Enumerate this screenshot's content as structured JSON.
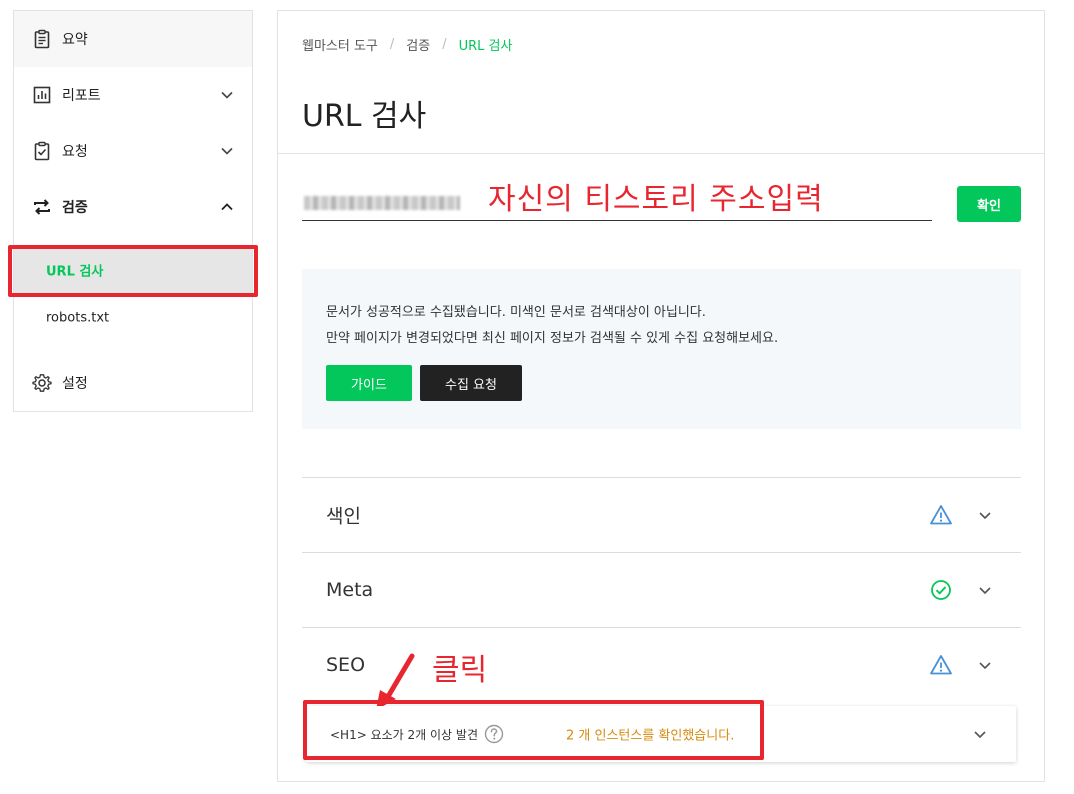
{
  "sidebar": {
    "items": [
      {
        "label": "요약",
        "icon": "clipboard-list-icon"
      },
      {
        "label": "리포트",
        "icon": "bar-chart-icon"
      },
      {
        "label": "요청",
        "icon": "clipboard-check-icon"
      },
      {
        "label": "검증",
        "icon": "swap-arrows-icon"
      },
      {
        "label": "설정",
        "icon": "gear-icon"
      }
    ],
    "sub_items": [
      {
        "label": "URL 검사"
      },
      {
        "label": "robots.txt"
      }
    ]
  },
  "main": {
    "breadcrumb": [
      "웹마스터 도구",
      "검증",
      "URL 검사"
    ],
    "title": "URL 검사",
    "confirm_label": "확인",
    "annotation_url": "자신의 티스토리 주소입력",
    "notice": {
      "line1": "문서가 성공적으로 수집됐습니다. 미색인 문서로 검색대상이 아닙니다.",
      "line2": "만약 페이지가 변경되었다면 최신 페이지 정보가 검색될 수 있게 수집 요청해보세요.",
      "guide_label": "가이드",
      "crawl_label": "수집 요청"
    },
    "sections": [
      {
        "name": "색인",
        "status": "warning"
      },
      {
        "name": "Meta",
        "status": "ok"
      },
      {
        "name": "SEO",
        "status": "warning"
      }
    ],
    "annotation_click": "클릭",
    "issue": {
      "title": "<H1> 요소가 2개 이상 발견",
      "count_text": "2 개 인스턴스를 확인했습니다."
    }
  },
  "colors": {
    "accent": "#03c75a",
    "annotation": "#e8262f",
    "warning_icon": "#4a90d9",
    "issue_count": "#d68b0c"
  }
}
